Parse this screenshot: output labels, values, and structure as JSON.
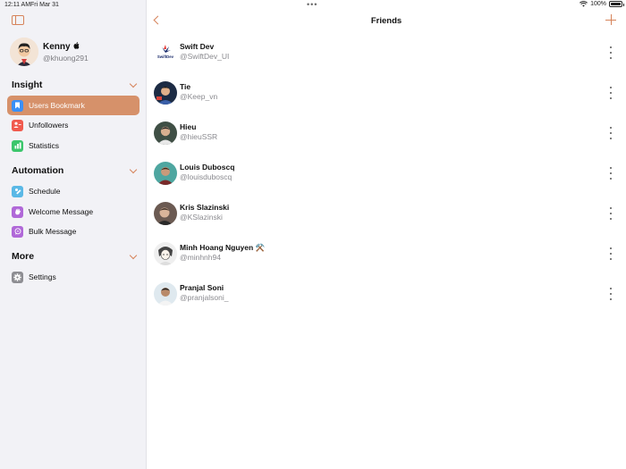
{
  "status_bar": {
    "time": "12:11 AM",
    "date": "Fri Mar 31",
    "battery_percent": "100%"
  },
  "sidebar": {
    "profile": {
      "name": "Kenny",
      "handle": "@khuong291",
      "badge_icon": "apple-icon"
    },
    "sections": [
      {
        "title": "Insight",
        "items": [
          {
            "label": "Users Bookmark",
            "icon": "bookmark-icon",
            "color": "#3a8ff7",
            "active": true
          },
          {
            "label": "Unfollowers",
            "icon": "person-remove-icon",
            "color": "#f05a4e",
            "active": false
          },
          {
            "label": "Statistics",
            "icon": "bar-chart-icon",
            "color": "#3cc66c",
            "active": false
          }
        ]
      },
      {
        "title": "Automation",
        "items": [
          {
            "label": "Schedule",
            "icon": "schedule-icon",
            "color": "#5ab8e6",
            "active": false
          },
          {
            "label": "Welcome Message",
            "icon": "wave-hand-icon",
            "color": "#b068d8",
            "active": false
          },
          {
            "label": "Bulk Message",
            "icon": "message-icon",
            "color": "#b068d8",
            "active": false
          }
        ]
      },
      {
        "title": "More",
        "items": [
          {
            "label": "Settings",
            "icon": "gear-icon",
            "color": "#8e8e93",
            "active": false
          }
        ]
      }
    ],
    "accent_color": "#d6835a",
    "active_bg": "#d6916a"
  },
  "main": {
    "title": "Friends",
    "friends": [
      {
        "name": "Swift Dev",
        "handle": "@SwiftDev_UI",
        "avatar_text": "SwiftDev"
      },
      {
        "name": "Tie",
        "handle": "@Keep_vn"
      },
      {
        "name": "Hieu",
        "handle": "@hieuSSR"
      },
      {
        "name": "Louis Duboscq",
        "handle": "@louisduboscq"
      },
      {
        "name": "Kris Slazinski",
        "handle": "@KSlazinski"
      },
      {
        "name": "Minh Hoang Nguyen ⚒️",
        "handle": "@minhnh94"
      },
      {
        "name": "Pranjal Soni",
        "handle": "@pranjalsoni_"
      }
    ]
  }
}
